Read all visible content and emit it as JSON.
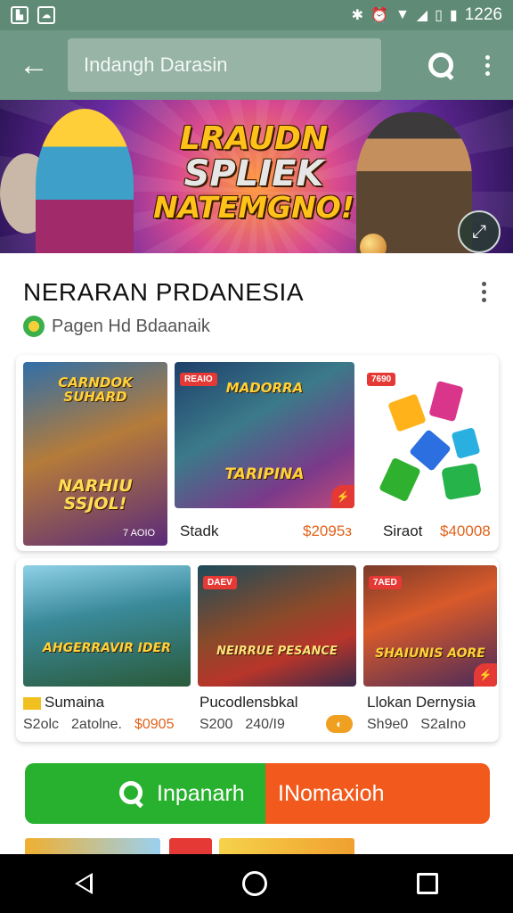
{
  "status_bar": {
    "time": "1226",
    "left_icons": [
      "gallery-icon",
      "cloud-icon"
    ],
    "right_icons": [
      "bluetooth-icon",
      "alarm-icon",
      "wifi-icon",
      "signal-icon",
      "vibrate-icon",
      "battery-icon"
    ]
  },
  "app_bar": {
    "search_value": "Indangh Darasin",
    "back_icon": "arrow-back-icon",
    "search_icon": "search-icon",
    "menu_icon": "more-vert-icon"
  },
  "banner": {
    "title_line1": "LRAUDN",
    "title_line2": "SPLIEK",
    "title_line3": "NATEMGNO!",
    "fab_icon": "expand-icon"
  },
  "section": {
    "title": "NERARAN PRDANESIA",
    "subtitle": "Pagen Hd Bdaanaik"
  },
  "row1": [
    {
      "art_text": "CARNDOK SUHARD",
      "art_text2": "NARHIU SSJOL!",
      "footer": "7 AOIO"
    },
    {
      "badge": "REAIO",
      "art_text": "MADORRA",
      "art_text2": "TARIPINA",
      "name": "Stadk",
      "price": "$2095з"
    },
    {
      "badge": "7690",
      "name": "Siraot",
      "price": "$40008"
    }
  ],
  "row2": [
    {
      "art_text": "AHGERRAVIR IDER",
      "name": "Sumaina",
      "sub1": "S2olc",
      "sub2": "2atolne.",
      "price": "$0905"
    },
    {
      "badge": "DAEV",
      "art_text": "NEIRRUE PESANCE",
      "name": "Pucodlensbkal",
      "sub1": "S200",
      "sub2": "240/I9"
    },
    {
      "badge": "7AED",
      "art_text": "SHAIUNIS AORE",
      "name": "Llokan Dernysia",
      "sub1": "Sh9e0",
      "sub2": "S2aIno"
    }
  ],
  "buttons": {
    "left_label": "Inpanarh",
    "right_label": "INomaxioh"
  },
  "colors": {
    "status_bar": "#5f8a76",
    "app_bar": "#6f9886",
    "accent_green": "#28b12e",
    "accent_orange": "#f15a1c",
    "price": "#e0631c"
  }
}
